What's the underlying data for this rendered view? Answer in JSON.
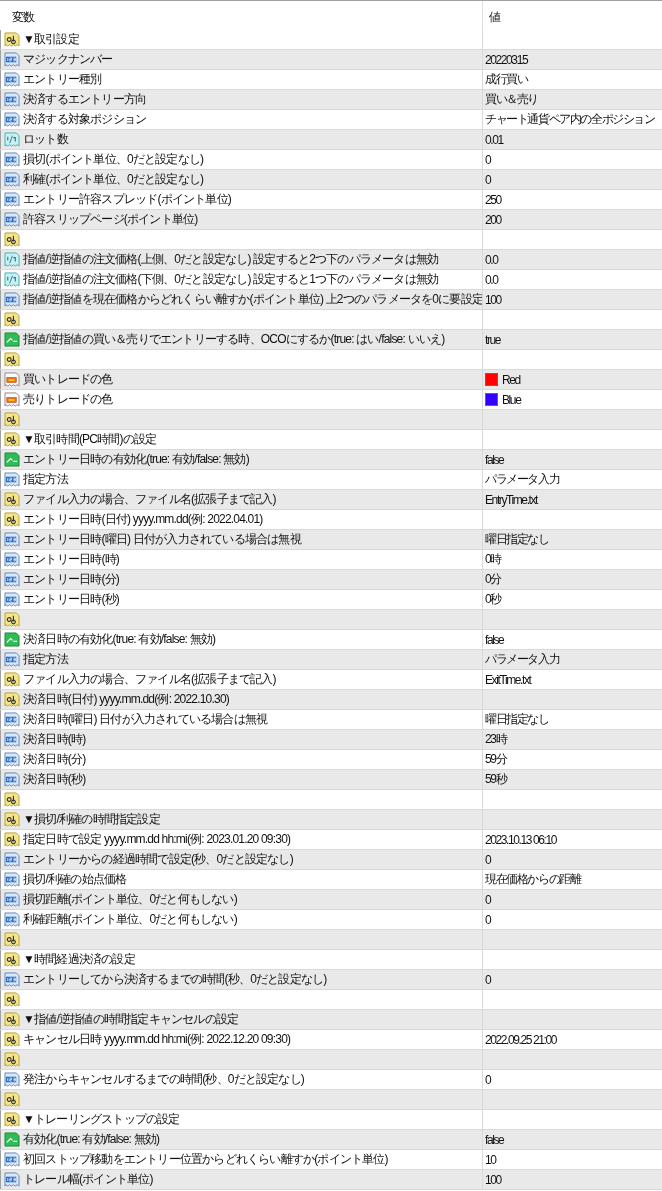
{
  "columns": [
    "変数",
    "値"
  ],
  "rows": [
    {
      "kind": "string",
      "name": "▼取引設定"
    },
    {
      "kind": "int",
      "name": "マジックナンバー",
      "value": "20220315"
    },
    {
      "kind": "int",
      "name": "エントリー種別",
      "value": "成行買い"
    },
    {
      "kind": "int",
      "name": "決済するエントリー方向",
      "value": "買い＆売り"
    },
    {
      "kind": "int",
      "name": "決済する対象ポジション",
      "value": "チャート通貨ペア内の全ポジション"
    },
    {
      "kind": "double",
      "name": "ロット数",
      "value": "0.01"
    },
    {
      "kind": "int",
      "name": "損切(ポイント単位、0だと設定なし)",
      "value": "0"
    },
    {
      "kind": "int",
      "name": "利確(ポイント単位、0だと設定なし)",
      "value": "0"
    },
    {
      "kind": "int",
      "name": "エントリー許容スプレッド(ポイント単位)",
      "value": "250"
    },
    {
      "kind": "int",
      "name": "許容スリップページ(ポイント単位)",
      "value": "200"
    },
    {
      "kind": "string"
    },
    {
      "kind": "double",
      "name": "指値/逆指値の注文価格(上側、0だと設定なし) 設定すると2つ下のパラメータは無効",
      "value": "0.0"
    },
    {
      "kind": "double",
      "name": "指値/逆指値の注文価格(下側、0だと設定なし) 設定すると1つ下のパラメータは無効",
      "value": "0.0"
    },
    {
      "kind": "int",
      "name": "指値/逆指値を現在価格からどれくらい離すか(ポイント単位) 上2つのパラメータを0に要設定",
      "value": "100"
    },
    {
      "kind": "string"
    },
    {
      "kind": "bool",
      "name": "指値/逆指値の買い＆売りでエントリーする時、OCOにするか(true: はい/false: いいえ)",
      "value": "true"
    },
    {
      "kind": "string"
    },
    {
      "kind": "color",
      "name": "買いトレードの色",
      "value": "Red",
      "color": "#ff0000"
    },
    {
      "kind": "color",
      "name": "売りトレードの色",
      "value": "Blue",
      "color": "#3300ff"
    },
    {
      "kind": "string"
    },
    {
      "kind": "string",
      "name": "▼取引時間(PC時間)の設定"
    },
    {
      "kind": "bool",
      "name": "エントリー日時の有効化(true: 有効/false: 無効)",
      "value": "false"
    },
    {
      "kind": "int",
      "name": "指定方法",
      "value": "パラメータ入力"
    },
    {
      "kind": "string",
      "name": "ファイル入力の場合、ファイル名(拡張子まで記入)",
      "value": "EntryTime.txt"
    },
    {
      "kind": "string",
      "name": "エントリー日時(日付) yyyy.mm.dd(例: 2022.04.01)"
    },
    {
      "kind": "int",
      "name": "エントリー日時(曜日) 日付が入力されている場合は無視",
      "value": "曜日指定なし"
    },
    {
      "kind": "int",
      "name": "エントリー日時(時)",
      "value": "0時"
    },
    {
      "kind": "int",
      "name": "エントリー日時(分)",
      "value": "0分"
    },
    {
      "kind": "int",
      "name": "エントリー日時(秒)",
      "value": "0秒"
    },
    {
      "kind": "string"
    },
    {
      "kind": "bool",
      "name": "決済日時の有効化(true: 有効/false: 無効)",
      "value": "false"
    },
    {
      "kind": "int",
      "name": "指定方法",
      "value": "パラメータ入力"
    },
    {
      "kind": "string",
      "name": "ファイル入力の場合、ファイル名(拡張子まで記入)",
      "value": "ExitTime.txt"
    },
    {
      "kind": "string",
      "name": "決済日時(日付) yyyy.mm.dd(例: 2022.10.30)"
    },
    {
      "kind": "int",
      "name": "決済日時(曜日) 日付が入力されている場合は無視",
      "value": "曜日指定なし"
    },
    {
      "kind": "int",
      "name": "決済日時(時)",
      "value": "23時"
    },
    {
      "kind": "int",
      "name": "決済日時(分)",
      "value": "59分"
    },
    {
      "kind": "int",
      "name": "決済日時(秒)",
      "value": "59秒"
    },
    {
      "kind": "string"
    },
    {
      "kind": "string",
      "name": "▼損切/利確の時間指定設定"
    },
    {
      "kind": "string",
      "name": "指定日時で設定 yyyy.mm.dd hh:mi(例: 2023.01.20 09:30)",
      "value": "2023.10.13 06:10"
    },
    {
      "kind": "int",
      "name": "エントリーからの経過時間で設定(秒、0だと設定なし)",
      "value": "0"
    },
    {
      "kind": "int",
      "name": "損切/利確の始点価格",
      "value": "現在価格からの距離"
    },
    {
      "kind": "int",
      "name": "損切距離(ポイント単位、0だと何もしない)",
      "value": "0"
    },
    {
      "kind": "int",
      "name": "利確距離(ポイント単位、0だと何もしない)",
      "value": "0"
    },
    {
      "kind": "string"
    },
    {
      "kind": "string",
      "name": "▼時間経過決済の設定"
    },
    {
      "kind": "int",
      "name": "エントリーしてから決済するまでの時間(秒、0だと設定なし)",
      "value": "0"
    },
    {
      "kind": "string"
    },
    {
      "kind": "string",
      "name": "▼指値/逆指値の時間指定キャンセルの設定"
    },
    {
      "kind": "string",
      "name": "キャンセル日時 yyyy.mm.dd hh:mi(例: 2022.12.20 09:30)",
      "value": "2022.09.25 21:00"
    },
    {
      "kind": "string"
    },
    {
      "kind": "int",
      "name": "発注からキャンセルするまでの時間(秒、0だと設定なし)",
      "value": "0"
    },
    {
      "kind": "string"
    },
    {
      "kind": "string",
      "name": "▼トレーリングストップの設定"
    },
    {
      "kind": "bool",
      "name": "有効化(true: 有効/false: 無効)",
      "value": "false"
    },
    {
      "kind": "int",
      "name": "初回ストップ移動をエントリー位置からどれくらい離すか(ポイント単位)",
      "value": "10"
    },
    {
      "kind": "int",
      "name": "トレール幅(ポイント単位)",
      "value": "100"
    }
  ]
}
